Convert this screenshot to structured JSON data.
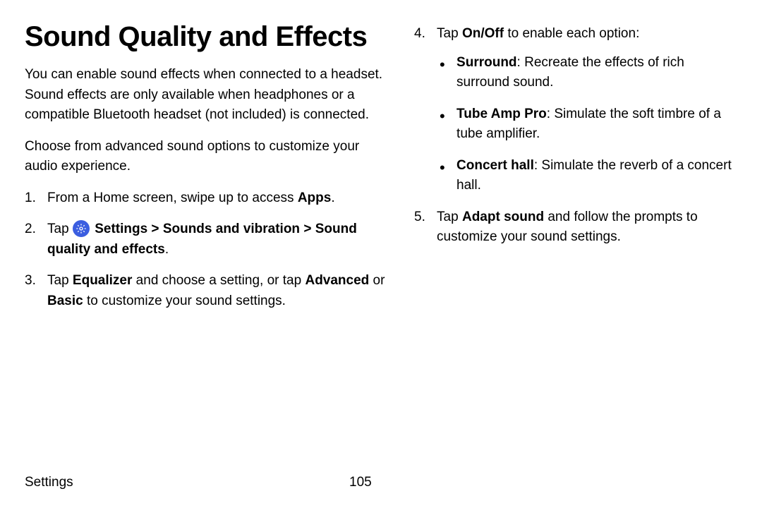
{
  "title": "Sound Quality and Effects",
  "intro1": "You can enable sound effects when connected to a headset. Sound effects are only available when headphones or a compatible Bluetooth headset (not included) is connected.",
  "intro2": "Choose from advanced sound options to customize your audio experience.",
  "step1_pre": "From a Home screen, swipe up to access ",
  "step1_bold": "Apps",
  "step1_post": ".",
  "step2_pre": "Tap ",
  "step2_settings": "Settings",
  "step2_gt1": " > ",
  "step2_sounds": "Sounds and vibration",
  "step2_gt2": " > ",
  "step2_sq": "Sound quality and effects",
  "step2_post": ".",
  "step3_tap": "Tap ",
  "step3_eq": "Equalizer",
  "step3_mid1": " and choose a setting, or tap ",
  "step3_adv": "Advanced",
  "step3_or": " or ",
  "step3_basic": "Basic",
  "step3_post": " to customize your sound settings.",
  "step4_tap": "Tap ",
  "step4_onoff": "On/Off",
  "step4_post": " to enable each option:",
  "b1_title": "Surround",
  "b1_desc": ": Recreate the effects of rich surround sound.",
  "b2_title": "Tube Amp Pro",
  "b2_desc": ": Simulate the soft timbre of a tube amplifier.",
  "b3_title": "Concert hall",
  "b3_desc": ": Simulate the reverb of a concert hall.",
  "step5_tap": "Tap ",
  "step5_adapt": "Adapt sound",
  "step5_post": " and follow the prompts to customize your sound settings.",
  "footer_label": "Settings",
  "footer_page": "105"
}
